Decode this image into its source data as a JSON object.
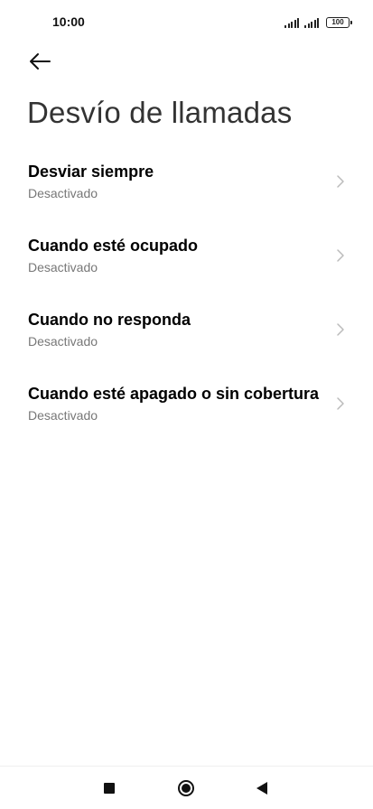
{
  "status_bar": {
    "time": "10:00",
    "battery": "100",
    "icons": [
      "signal-icon",
      "signal-icon",
      "battery-icon"
    ]
  },
  "header": {
    "back_icon": "arrow-left-icon",
    "title": "Desvío de llamadas"
  },
  "menu": {
    "items": [
      {
        "title": "Desviar siempre",
        "subtitle": "Desactivado"
      },
      {
        "title": "Cuando esté ocupado",
        "subtitle": "Desactivado"
      },
      {
        "title": "Cuando no responda",
        "subtitle": "Desactivado"
      },
      {
        "title": "Cuando esté apagado o sin cobertura",
        "subtitle": "Desactivado"
      }
    ],
    "chevron_icon": "chevron-right-icon"
  },
  "nav_bar": {
    "icons": [
      "recents-square-icon",
      "home-circle-icon",
      "back-triangle-icon"
    ]
  },
  "colors": {
    "background": "#ffffff",
    "title_text": "#333333",
    "item_title": "#000000",
    "item_subtitle": "#777777",
    "chevron": "#bbbbbb"
  }
}
